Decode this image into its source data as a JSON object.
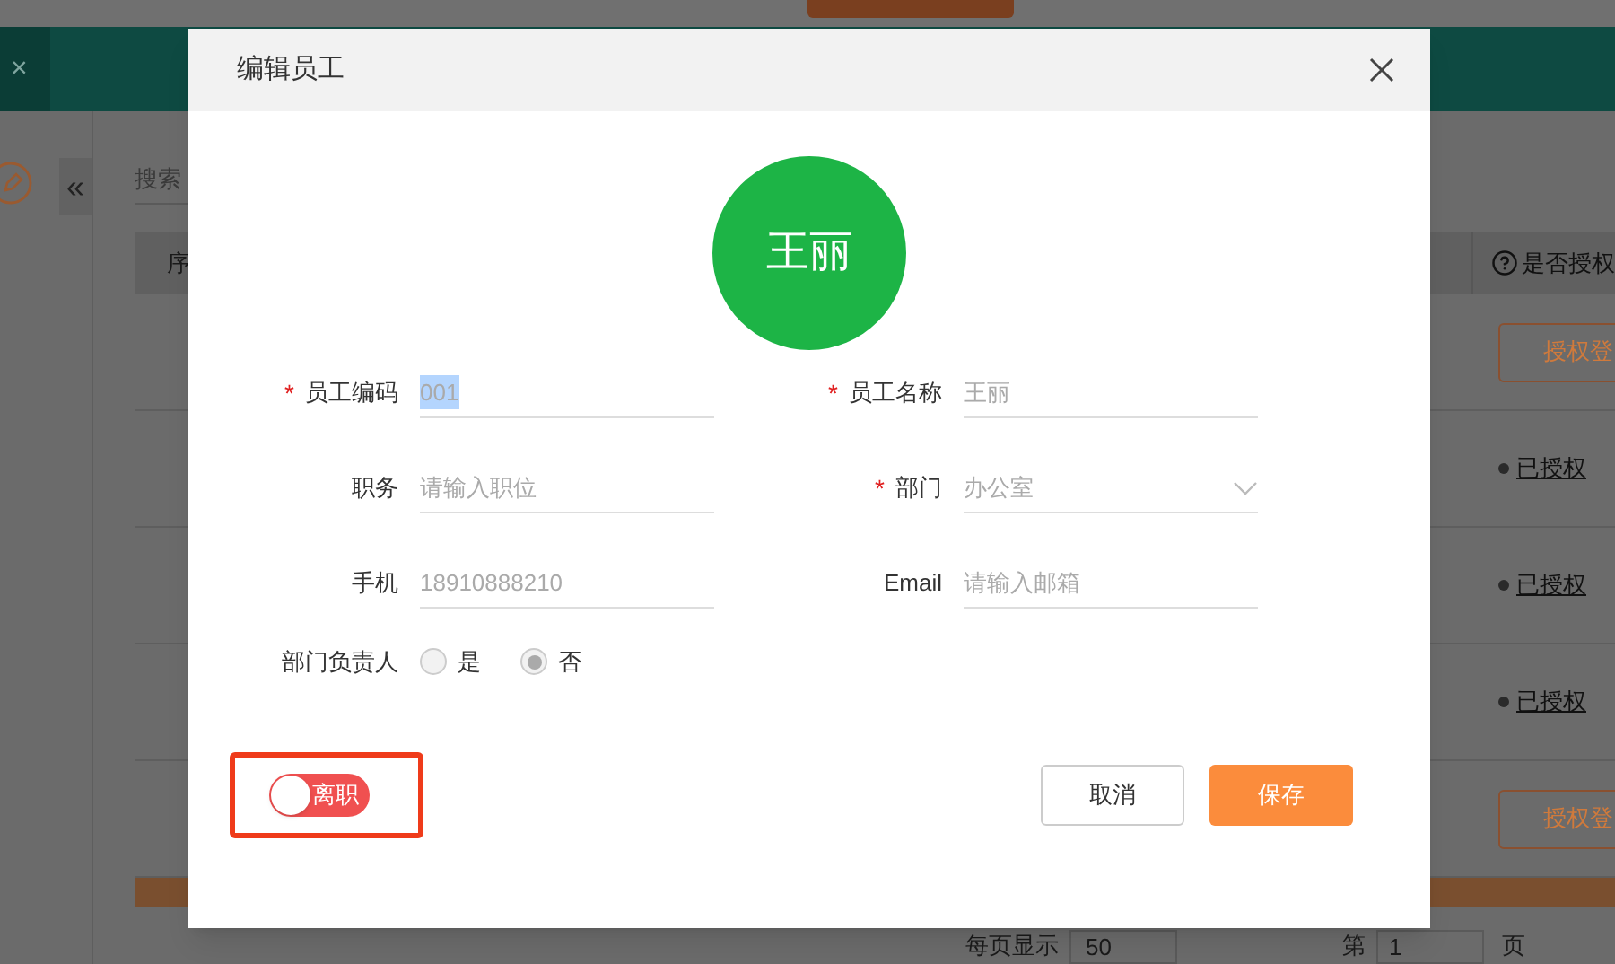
{
  "background": {
    "tab_close": "×",
    "collapse": "«",
    "search_placeholder": "搜索",
    "table": {
      "columns": [
        "序",
        "是否授权"
      ],
      "rows": [
        {
          "kind": "button",
          "label": "授权登"
        },
        {
          "kind": "status",
          "label": "已授权"
        },
        {
          "kind": "status",
          "label": "已授权"
        },
        {
          "kind": "status",
          "label": "已授权"
        },
        {
          "kind": "button",
          "label": "授权登"
        }
      ]
    },
    "pagination": {
      "per_page_label": "每页显示",
      "per_page": "50",
      "page_prefix": "第",
      "page": "1",
      "page_suffix": "页"
    }
  },
  "dialog": {
    "title": "编辑员工",
    "avatar": "王丽",
    "required_mark": "*",
    "fields": [
      {
        "kind": "text",
        "required": true,
        "label": "员工编码",
        "value": "001",
        "highlighted": true
      },
      {
        "kind": "text",
        "required": true,
        "label": "员工名称",
        "value": "王丽",
        "highlighted": false
      },
      {
        "kind": "text",
        "required": false,
        "label": "职务",
        "placeholder": "请输入职位"
      },
      {
        "kind": "select",
        "required": true,
        "label": "部门",
        "value": "办公室"
      },
      {
        "kind": "text",
        "required": false,
        "label": "手机",
        "value": "18910888210",
        "highlighted": false
      },
      {
        "kind": "text",
        "required": false,
        "label": "Email",
        "placeholder": "请输入邮箱"
      }
    ],
    "radio": {
      "label": "部门负责人",
      "options": [
        {
          "label": "是",
          "selected": false
        },
        {
          "label": "否",
          "selected": true
        }
      ]
    },
    "toggle": {
      "label": "离职",
      "on": false,
      "highlighted": true
    },
    "buttons": [
      {
        "kind": "secondary",
        "label": "取消"
      },
      {
        "kind": "primary",
        "label": "保存"
      }
    ]
  }
}
